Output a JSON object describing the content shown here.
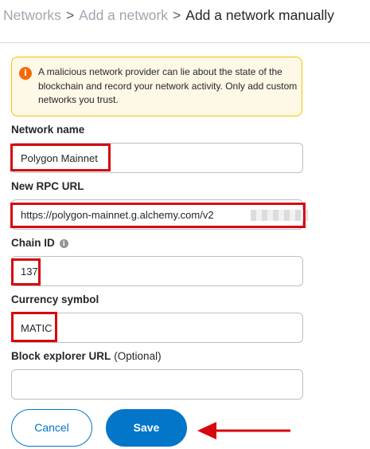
{
  "breadcrumb": {
    "items": [
      "Networks",
      "Add a network",
      "Add a network manually"
    ],
    "separator": ">"
  },
  "warning": {
    "icon": "info-icon",
    "text": "A malicious network provider can lie about the state of the blockchain and record your network activity. Only add custom networks you trust."
  },
  "form": {
    "network_name": {
      "label": "Network name",
      "value": "Polygon Mainnet"
    },
    "rpc_url": {
      "label": "New RPC URL",
      "value": "https://polygon-mainnet.g.alchemy.com/v2"
    },
    "chain_id": {
      "label": "Chain ID",
      "value": "137"
    },
    "currency_symbol": {
      "label": "Currency symbol",
      "value": "MATIC"
    },
    "block_explorer": {
      "label": "Block explorer URL",
      "optional": "(Optional)",
      "value": ""
    }
  },
  "buttons": {
    "cancel": "Cancel",
    "save": "Save"
  },
  "colors": {
    "accent": "#0376c9",
    "warning_border": "#f8c000",
    "warning_bg": "#fef8e6",
    "highlight": "#d7060f"
  }
}
